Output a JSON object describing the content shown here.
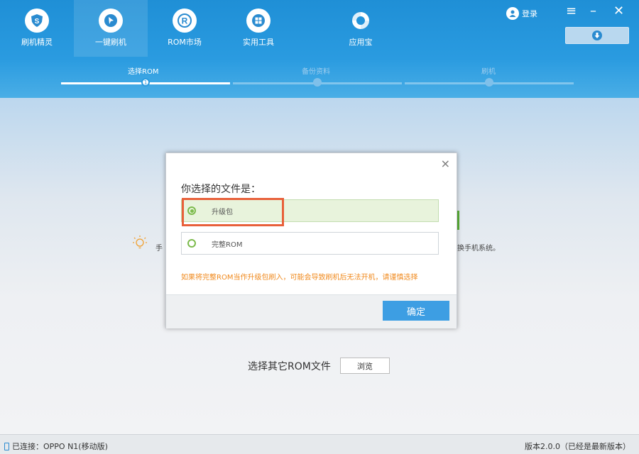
{
  "nav": [
    {
      "label": "刷机精灵",
      "icon": "shield-s-icon"
    },
    {
      "label": "一键刷机",
      "icon": "cursor-icon"
    },
    {
      "label": "ROM市场",
      "icon": "r-circle-icon"
    },
    {
      "label": "实用工具",
      "icon": "grid-icon"
    },
    {
      "label": "应用宝",
      "icon": "app-store-icon"
    }
  ],
  "header": {
    "login": "登录",
    "menu_glyph": "≡",
    "minimize_glyph": "–",
    "close_glyph": "✕"
  },
  "steps": [
    {
      "label": "选择ROM",
      "number": "1"
    },
    {
      "label": "备份资料",
      "number": ""
    },
    {
      "label": "刷机",
      "number": ""
    }
  ],
  "dialog": {
    "close_glyph": "×",
    "title": "你选择的文件是：",
    "options": [
      {
        "label": "升级包",
        "selected": true
      },
      {
        "label": "完整ROM",
        "selected": false
      }
    ],
    "warning": "如果将完整ROM当作升级包刷入，可能会导致刷机后无法开机，请谨慎选择",
    "confirm": "确定"
  },
  "background": {
    "hint_left": "手",
    "hint_right": "换手机系统。",
    "other_rom": "选择其它ROM文件",
    "browse": "浏览"
  },
  "status": {
    "connection": "已连接：OPPO N1(移动版)",
    "version": "版本2.0.0（已经是最新版本）"
  },
  "colors": {
    "header_blue": "#2a9be0",
    "confirm_blue": "#3d9ee3",
    "selected_green": "#e8f3dc",
    "warning_orange": "#f08a1e",
    "highlight_red": "#e8603a"
  }
}
